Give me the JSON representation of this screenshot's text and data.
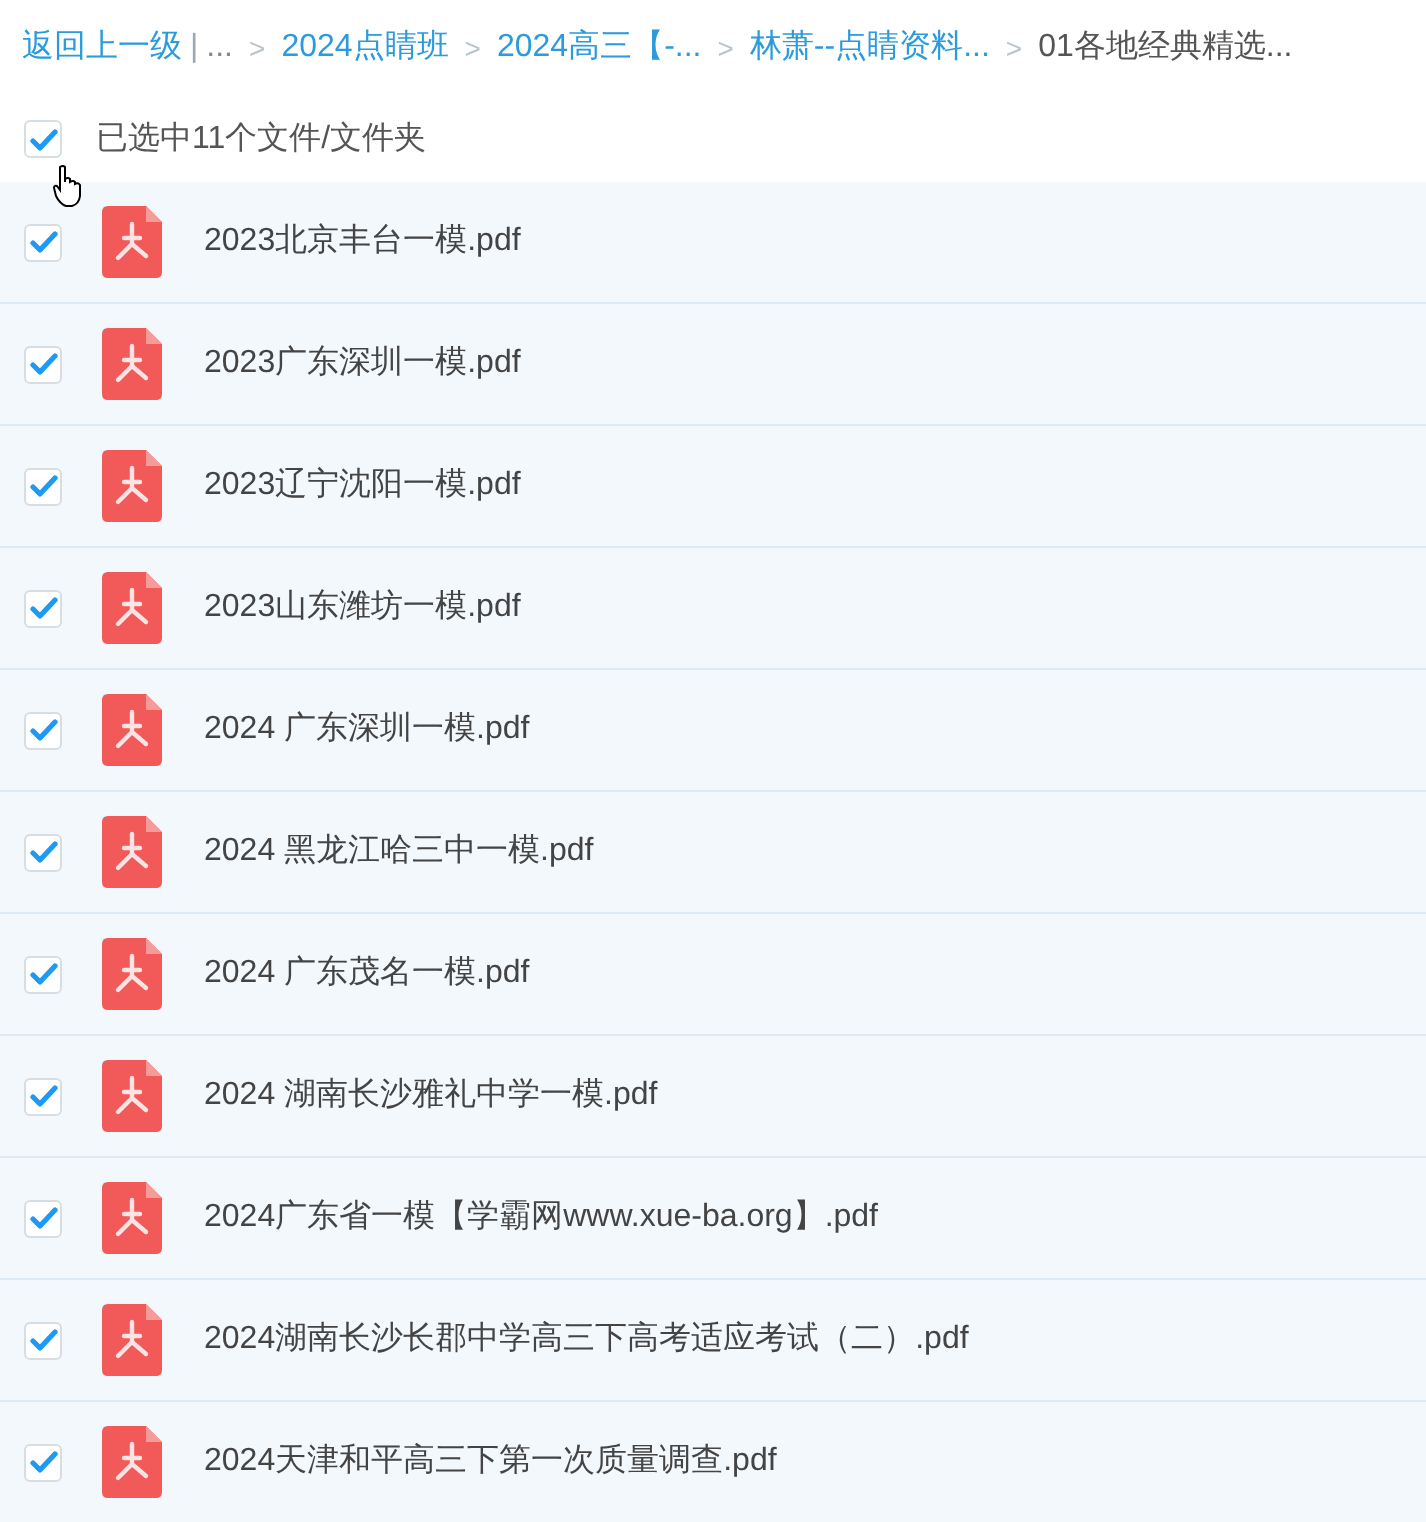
{
  "breadcrumb": {
    "back": "返回上一级",
    "divider": "|",
    "crumbs": [
      {
        "label": "...",
        "kind": "ellipsis"
      },
      {
        "sep": ">",
        "label": "2024点睛班",
        "kind": "link"
      },
      {
        "sep": ">",
        "label": "2024高三【-...",
        "kind": "link"
      },
      {
        "sep": ">",
        "label": "林萧--点睛资料...",
        "kind": "link"
      },
      {
        "sep": ">",
        "label": "01各地经典精选...",
        "kind": "current"
      }
    ]
  },
  "selection": {
    "checked": true,
    "label": "已选中11个文件/文件夹"
  },
  "files": [
    {
      "name": "2023北京丰台一模.pdf",
      "checked": true
    },
    {
      "name": "2023广东深圳一模.pdf",
      "checked": true
    },
    {
      "name": "2023辽宁沈阳一模.pdf",
      "checked": true
    },
    {
      "name": "2023山东潍坊一模.pdf",
      "checked": true
    },
    {
      "name": "2024 广东深圳一模.pdf",
      "checked": true
    },
    {
      "name": "2024 黑龙江哈三中一模.pdf",
      "checked": true
    },
    {
      "name": "2024 广东茂名一模.pdf",
      "checked": true
    },
    {
      "name": "2024 湖南长沙雅礼中学一模.pdf",
      "checked": true
    },
    {
      "name": "2024广东省一模【学霸网www.xue-ba.org】.pdf",
      "checked": true
    },
    {
      "name": "2024湖南长沙长郡中学高三下高考适应考试（二）.pdf",
      "checked": true
    },
    {
      "name": "2024天津和平高三下第一次质量调查.pdf",
      "checked": true
    }
  ]
}
